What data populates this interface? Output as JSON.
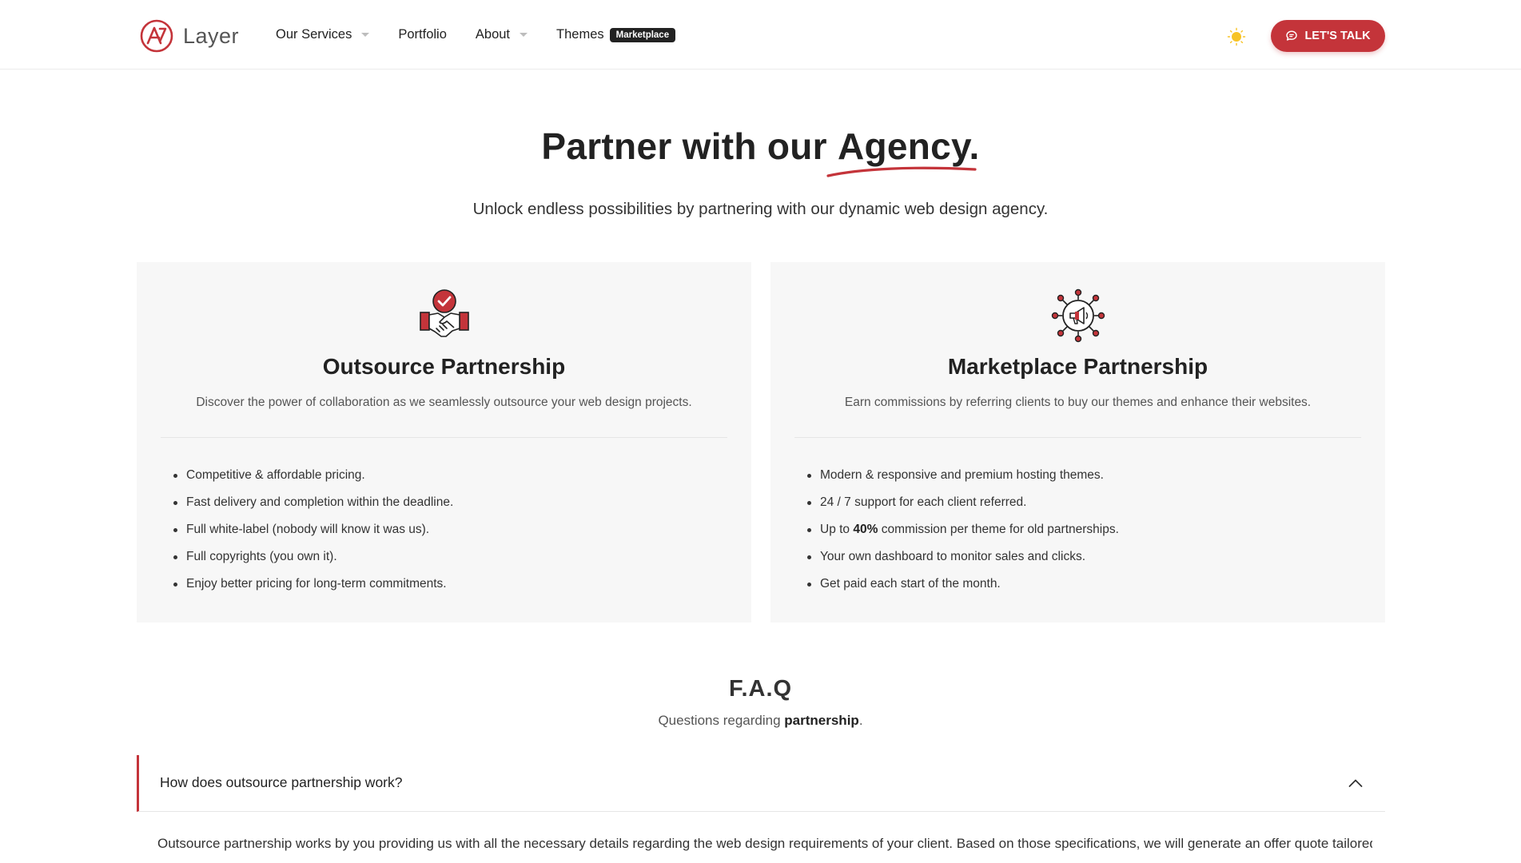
{
  "brand": {
    "name": "Layer",
    "accent": "#c4343a"
  },
  "nav": {
    "items": [
      {
        "label": "Our Services",
        "has_dropdown": true
      },
      {
        "label": "Portfolio",
        "has_dropdown": false
      },
      {
        "label": "About",
        "has_dropdown": true
      },
      {
        "label": "Themes",
        "has_dropdown": false,
        "badge": "Marketplace"
      }
    ],
    "theme_toggle_icon": "sun-icon",
    "cta_label": "LET'S TALK",
    "cta_icon": "chat-icon"
  },
  "hero": {
    "title_prefix": "Partner with our ",
    "title_highlight": "Agency.",
    "subtitle": "Unlock endless possibilities by partnering with our dynamic web design agency."
  },
  "cards": [
    {
      "icon": "handshake-icon",
      "title_bold": "Outsource",
      "title_rest": " Partnership",
      "description": "Discover the power of collaboration as we seamlessly outsource your web design projects.",
      "features": [
        "Competitive & affordable pricing.",
        "Fast delivery and completion within the deadline.",
        "Full white-label (nobody will know it was us).",
        "Full copyrights (you own it).",
        "Enjoy better pricing for long-term commitments."
      ]
    },
    {
      "icon": "megaphone-network-icon",
      "title_bold": "Marketplace",
      "title_rest": " Partnership",
      "description": "Earn commissions by referring clients to buy our themes and enhance their websites.",
      "features": [
        "Modern & responsive and premium hosting themes.",
        "24 / 7 support for each client referred.",
        {
          "prefix": "Up to ",
          "bold": "40%",
          "suffix": " commission per theme for old partnerships."
        },
        "Your own dashboard to monitor sales and clicks.",
        "Get paid each start of the month."
      ]
    }
  ],
  "faq": {
    "title": "F.A.Q",
    "subtitle_prefix": "Questions regarding ",
    "subtitle_bold": "partnership",
    "subtitle_suffix": ".",
    "items": [
      {
        "question": "How does outsource partnership work?",
        "expanded": true,
        "answer": "Outsource partnership works by you providing us with all the necessary details regarding the web design requirements of your client. Based on those specifications, we will generate an offer quote tailored"
      }
    ]
  }
}
